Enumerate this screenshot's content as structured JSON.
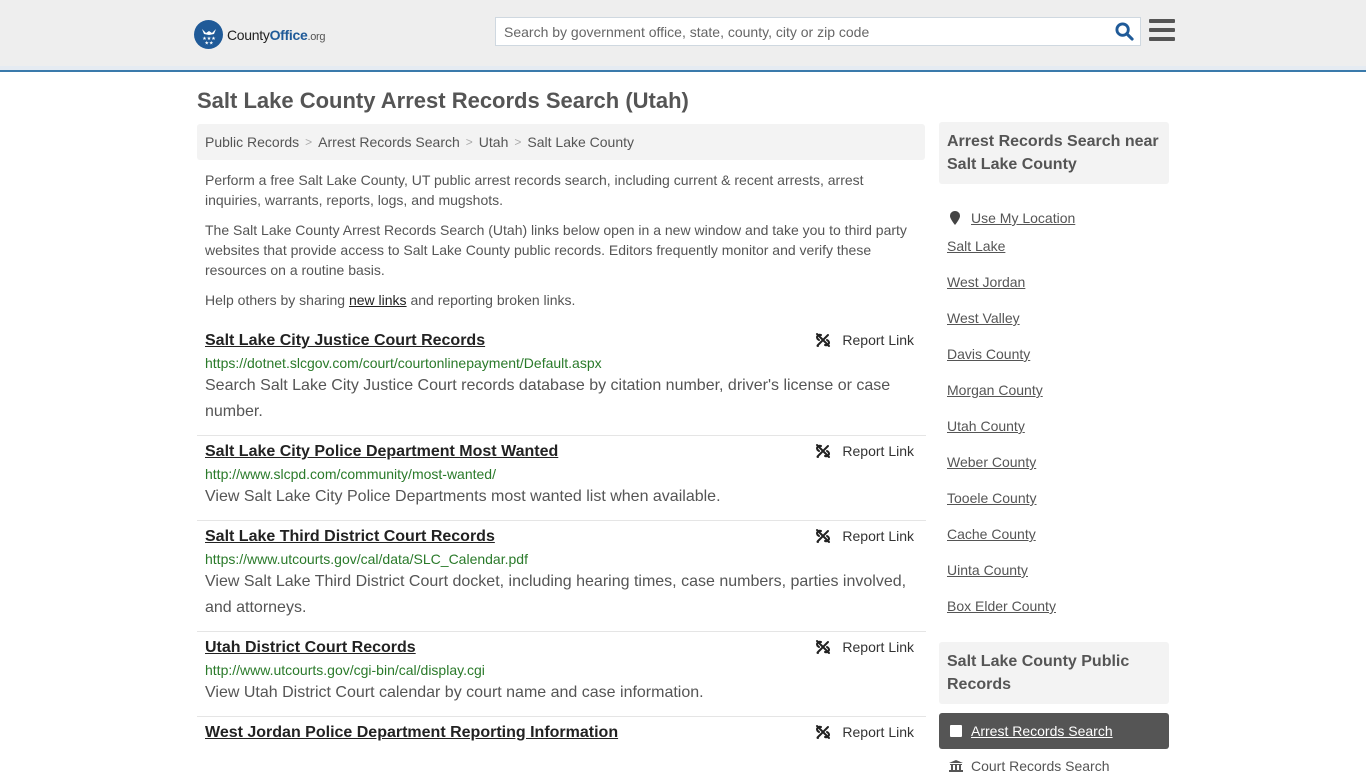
{
  "header": {
    "logo": {
      "name": "County",
      "name_bold": "Office",
      "tld": ".org"
    },
    "search_placeholder": "Search by government office, state, county, city or zip code",
    "search_value": ""
  },
  "page_title": "Salt Lake County Arrest Records Search (Utah)",
  "breadcrumb": [
    "Public Records",
    "Arrest Records Search",
    "Utah",
    "Salt Lake County"
  ],
  "intro": {
    "p1": "Perform a free Salt Lake County, UT public arrest records search, including current & recent arrests, arrest inquiries, warrants, reports, logs, and mugshots.",
    "p2": "The Salt Lake County Arrest Records Search (Utah) links below open in a new window and take you to third party websites that provide access to Salt Lake County public records. Editors frequently monitor and verify these resources on a routine basis.",
    "p3_before": "Help others by sharing ",
    "p3_link": "new links",
    "p3_after": " and reporting broken links."
  },
  "report_label": "Report Link",
  "results": [
    {
      "title": "Salt Lake City Justice Court Records",
      "url": "https://dotnet.slcgov.com/court/courtonlinepayment/Default.aspx",
      "desc": "Search Salt Lake City Justice Court records database by citation number, driver's license or case number."
    },
    {
      "title": "Salt Lake City Police Department Most Wanted",
      "url": "http://www.slcpd.com/community/most-wanted/",
      "desc": "View Salt Lake City Police Departments most wanted list when available."
    },
    {
      "title": "Salt Lake Third District Court Records",
      "url": "https://www.utcourts.gov/cal/data/SLC_Calendar.pdf",
      "desc": "View Salt Lake Third District Court docket, including hearing times, case numbers, parties involved, and attorneys."
    },
    {
      "title": "Utah District Court Records",
      "url": "http://www.utcourts.gov/cgi-bin/cal/display.cgi",
      "desc": "View Utah District Court calendar by court name and case information."
    },
    {
      "title": "West Jordan Police Department Reporting Information",
      "url": "",
      "desc": ""
    }
  ],
  "sidebar": {
    "nearby_heading": "Arrest Records Search near Salt Lake County",
    "use_location": "Use My Location",
    "nearby": [
      "Salt Lake",
      "West Jordan",
      "West Valley",
      "Davis County",
      "Morgan County",
      "Utah County",
      "Weber County",
      "Tooele County",
      "Cache County",
      "Uinta County",
      "Box Elder County"
    ],
    "public_heading": "Salt Lake County Public Records",
    "active_item": "Arrest Records Search",
    "next_item": "Court Records Search"
  },
  "colors": {
    "brand_blue": "#1f5a98",
    "header_border": "#3a7aab",
    "url_green": "#2a7a2a"
  }
}
